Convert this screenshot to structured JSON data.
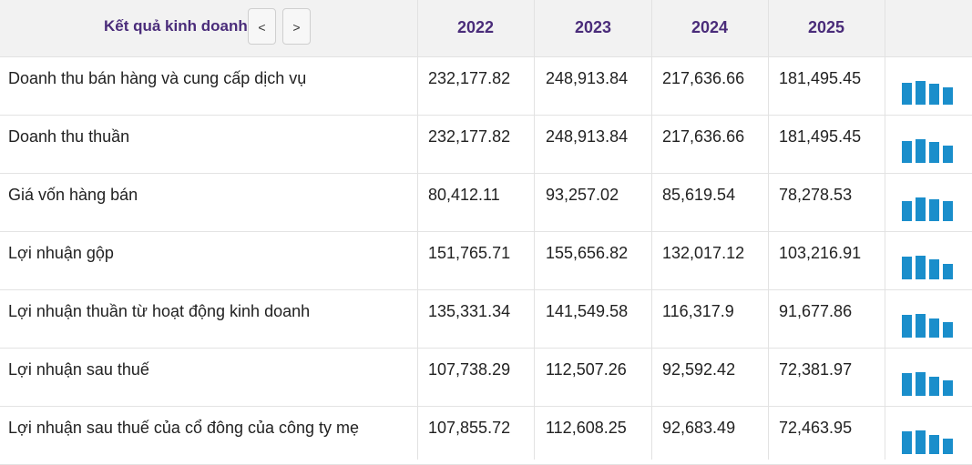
{
  "header": {
    "title": "Kết quả kinh doanh",
    "prev_label": "<",
    "next_label": ">",
    "years": [
      "2022",
      "2023",
      "2024",
      "2025"
    ]
  },
  "rows": [
    {
      "label": "Doanh thu bán hàng và cung cấp dịch vụ",
      "values": [
        "232,177.82",
        "248,913.84",
        "217,636.66",
        "181,495.45"
      ]
    },
    {
      "label": "Doanh thu thuần",
      "values": [
        "232,177.82",
        "248,913.84",
        "217,636.66",
        "181,495.45"
      ]
    },
    {
      "label": "Giá vốn hàng bán",
      "values": [
        "80,412.11",
        "93,257.02",
        "85,619.54",
        "78,278.53"
      ]
    },
    {
      "label": "Lợi nhuận gộp",
      "values": [
        "151,765.71",
        "155,656.82",
        "132,017.12",
        "103,216.91"
      ]
    },
    {
      "label": "Lợi nhuận thuần từ hoạt động kinh doanh",
      "values": [
        "135,331.34",
        "141,549.58",
        "116,317.9",
        "91,677.86"
      ]
    },
    {
      "label": "Lợi nhuận sau thuế",
      "values": [
        "107,738.29",
        "112,507.26",
        "92,592.42",
        "72,381.97"
      ]
    },
    {
      "label": "Lợi nhuận sau thuế của cổ đông của công ty mẹ",
      "values": [
        "107,855.72",
        "112,608.25",
        "92,683.49",
        "72,463.95"
      ]
    }
  ],
  "colors": {
    "accent": "#4a2c7a",
    "bar": "#1a8ecb",
    "header_bg": "#f2f2f2",
    "border": "#e2e2e2"
  }
}
